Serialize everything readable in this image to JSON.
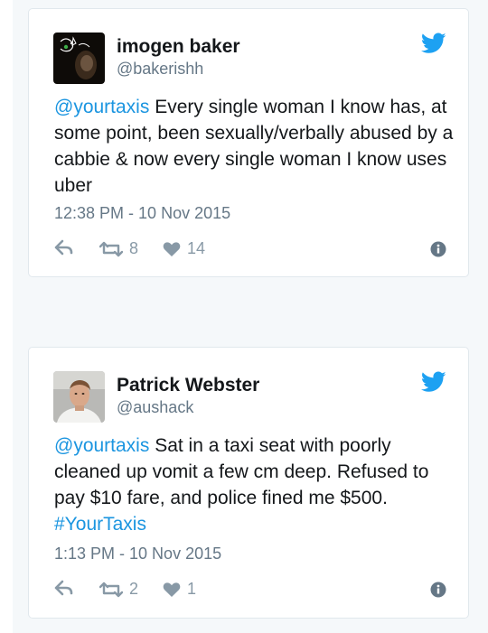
{
  "colors": {
    "background": "#f5f8fa",
    "card": "#ffffff",
    "border": "#e1e8ed",
    "link": "#1b95e0",
    "text": "#14171a",
    "muted": "#657786",
    "icon": "#8899a6"
  },
  "tweets": [
    {
      "name": "imogen baker",
      "handle": "@bakerishh",
      "mention": "@yourtaxis",
      "text": " Every single woman I know has, at some point, been sexually/verbally abused by a cabbie & now every single woman I know uses uber",
      "hashtag": "",
      "timestamp": "12:38 PM - 10 Nov 2015",
      "retweets": "8",
      "likes": "14",
      "icons": [
        "twitter-bird-icon",
        "reply-icon",
        "retweet-icon",
        "heart-icon",
        "info-icon"
      ]
    },
    {
      "name": "Patrick Webster",
      "handle": "@aushack",
      "mention": "@yourtaxis",
      "text": " Sat in a taxi seat with poorly cleaned up vomit a few cm deep. Refused to pay $10 fare, and police fined me $500. ",
      "hashtag": "#YourTaxis",
      "timestamp": "1:13 PM - 10 Nov 2015",
      "retweets": "2",
      "likes": "1",
      "icons": [
        "twitter-bird-icon",
        "reply-icon",
        "retweet-icon",
        "heart-icon",
        "info-icon"
      ]
    }
  ]
}
